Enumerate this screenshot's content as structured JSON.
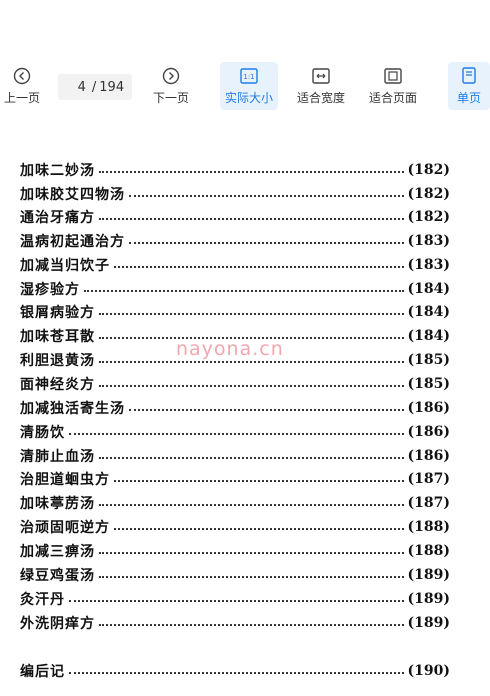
{
  "toolbar": {
    "prev_label": "上一页",
    "next_label": "下一页",
    "current_page": "4",
    "page_sep": "/",
    "total_pages": "194",
    "actual_size_label": "实际大小",
    "fit_width_label": "适合宽度",
    "fit_page_label": "适合页面",
    "single_page_label": "单页",
    "actual_size_icon_text": "1:1"
  },
  "colors": {
    "accent": "#1e7ce6",
    "active_bg": "#e8f2fd"
  },
  "toc": [
    {
      "title": "加味二妙汤",
      "page": "(182)"
    },
    {
      "title": "加味胶艾四物汤",
      "page": "(182)"
    },
    {
      "title": "通治牙痛方",
      "page": "(182)"
    },
    {
      "title": "温病初起通治方",
      "page": "(183)"
    },
    {
      "title": "加减当归饮子",
      "page": "(183)"
    },
    {
      "title": "湿疹验方",
      "page": "(184)"
    },
    {
      "title": "银屑病验方",
      "page": "(184)"
    },
    {
      "title": "加味苍耳散",
      "page": "(184)"
    },
    {
      "title": "利胆退黄汤",
      "page": "(185)"
    },
    {
      "title": "面神经炎方",
      "page": "(185)"
    },
    {
      "title": "加减独活寄生汤",
      "page": "(186)"
    },
    {
      "title": "清肠饮",
      "page": "(186)"
    },
    {
      "title": "清肺止血汤",
      "page": "(186)"
    },
    {
      "title": "治胆道蛔虫方",
      "page": "(187)"
    },
    {
      "title": "加味葶苈汤",
      "page": "(187)"
    },
    {
      "title": "治顽固呃逆方",
      "page": "(188)"
    },
    {
      "title": "加减三痹汤",
      "page": "(188)"
    },
    {
      "title": "绿豆鸡蛋汤",
      "page": "(189)"
    },
    {
      "title": "灸汗丹",
      "page": "(189)"
    },
    {
      "title": "外洗阴痒方",
      "page": "(189)"
    }
  ],
  "afterword": {
    "title": "编后记",
    "page": "(190)"
  },
  "watermark": "nayona.cn"
}
